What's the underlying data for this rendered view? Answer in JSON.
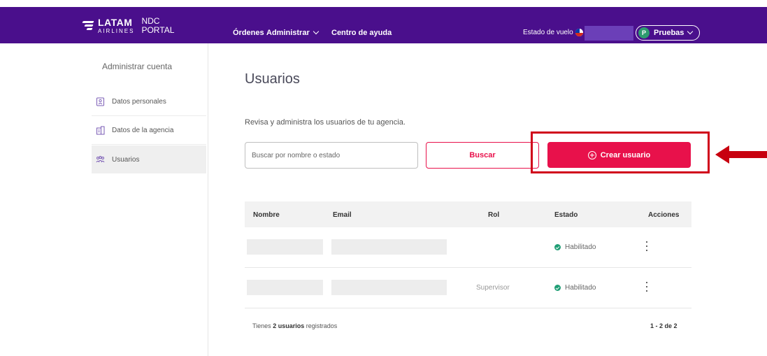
{
  "header": {
    "brand_latam": "LATAM",
    "brand_airlines": "AIRLINES",
    "portal_line1": "NDC",
    "portal_line2": "PORTAL",
    "nav": {
      "ordenes": "Órdenes",
      "administrar": "Administrar",
      "ayuda": "Centro de ayuda"
    },
    "estado_vuelo": "Estado de vuelo",
    "user_initial": "P",
    "user_name": "Pruebas",
    "brand_color": "#4a0f8c"
  },
  "sidebar": {
    "title": "Administrar cuenta",
    "items": [
      {
        "label": "Datos personales",
        "icon": "person-badge-icon"
      },
      {
        "label": "Datos de la agencia",
        "icon": "building-icon"
      },
      {
        "label": "Usuarios",
        "icon": "users-icon",
        "active": true
      }
    ]
  },
  "main": {
    "title": "Usuarios",
    "subtitle": "Revisa y administra los usuarios de tu agencia.",
    "search_placeholder": "Buscar por nombre o estado",
    "search_button": "Buscar",
    "create_button": "Crear usuario",
    "accent_color": "#e8114b"
  },
  "table": {
    "headers": [
      "Nombre",
      "Email",
      "Rol",
      "Estado",
      "Acciones"
    ],
    "rows": [
      {
        "nombre": "",
        "email": "",
        "rol": "",
        "estado": "Habilitado"
      },
      {
        "nombre": "",
        "email": "",
        "rol": "Supervisor",
        "estado": "Habilitado"
      }
    ],
    "footer_prefix": "Tienes ",
    "footer_count": "2 usuarios",
    "footer_suffix": " registrados",
    "pager": "1 - 2 de 2"
  }
}
